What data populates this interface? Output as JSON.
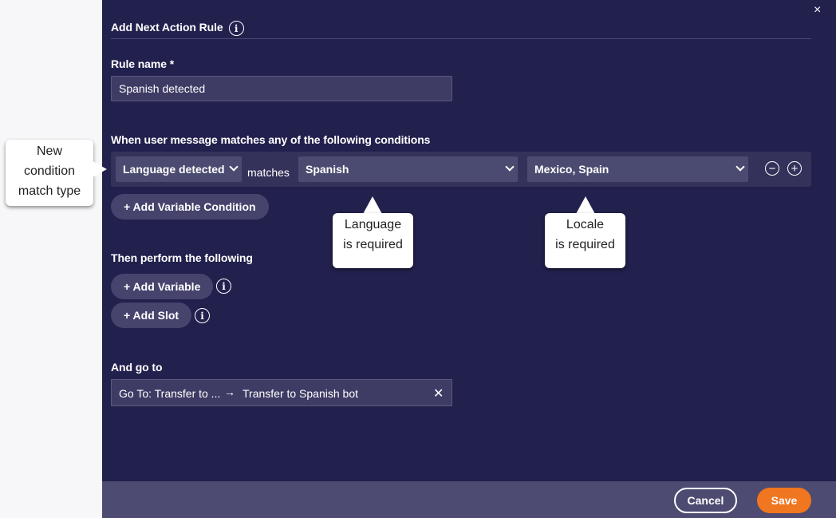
{
  "dialog": {
    "title": "Add Next Action Rule",
    "close_glyph": "×",
    "info_glyph": "i"
  },
  "rule_name": {
    "label": "Rule name *",
    "value": "Spanish detected"
  },
  "conditions": {
    "heading": "When user message matches any of the following conditions",
    "type_select": "Language detected",
    "matches_text": "matches",
    "language_select": "Spanish",
    "locale_select": "Mexico, Spain",
    "remove_glyph": "−",
    "add_glyph": "+",
    "add_variable_condition": "+ Add Variable Condition"
  },
  "actions": {
    "heading": "Then perform the following",
    "add_variable": "+ Add Variable",
    "add_slot": "+ Add Slot"
  },
  "goto": {
    "heading": "And go to",
    "left": "Go To: Transfer to ...",
    "arrow": "→",
    "right": "Transfer to Spanish bot",
    "clear_glyph": "✕"
  },
  "footer": {
    "cancel": "Cancel",
    "save": "Save"
  },
  "callouts": {
    "match_type": [
      "New",
      "condition",
      "match type"
    ],
    "language": [
      "Language",
      "is required"
    ],
    "locale": [
      "Locale",
      "is required"
    ]
  },
  "colors": {
    "panel_bg": "#22204d",
    "footer_bg": "#4d4b71",
    "accent_save": "#f0761f"
  }
}
